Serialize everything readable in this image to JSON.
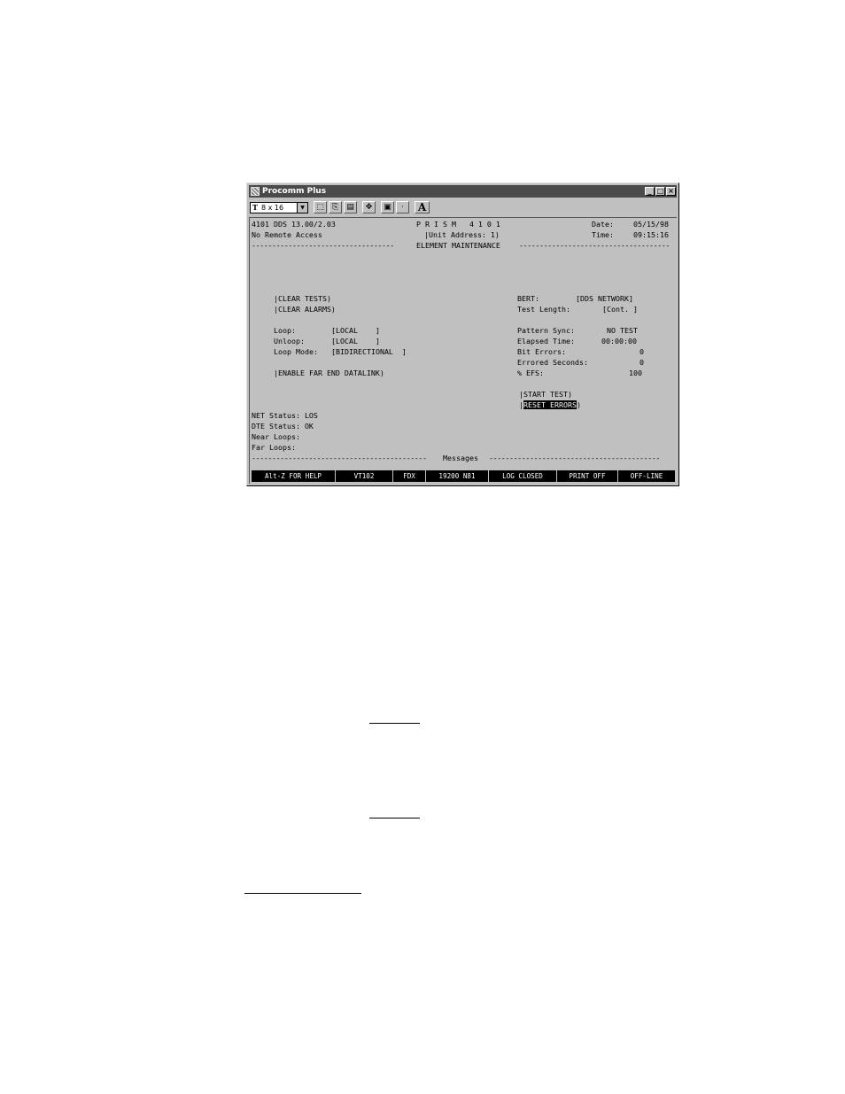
{
  "window": {
    "title": "Procomm Plus",
    "controls": {
      "minimize": "_",
      "maximize": "□",
      "close": "×"
    }
  },
  "toolbar": {
    "font_selector": "8 x 16",
    "font_icon": "T",
    "buttons": [
      {
        "name": "select-icon",
        "glyph": "⬚"
      },
      {
        "name": "copy-icon",
        "glyph": "⎘"
      },
      {
        "name": "paste-icon",
        "glyph": "▤"
      },
      {
        "name": "move-icon",
        "glyph": "✥"
      },
      {
        "name": "print-screen-icon",
        "glyph": "▣"
      },
      {
        "name": "dot-icon",
        "glyph": "·"
      },
      {
        "name": "font-a-icon",
        "glyph": "A"
      }
    ]
  },
  "terminal": {
    "header": {
      "version": "4101 DDS 13.00/2.03",
      "product": "P R I S M   4 1 0 1",
      "date_label": "Date:",
      "date": "05/15/98",
      "remote": "No Remote Access",
      "unit_address": "|Unit Address: 1)",
      "time_label": "Time:",
      "time": "09:15:16",
      "section_title": "ELEMENT MAINTENANCE"
    },
    "left": {
      "clear_tests": "|CLEAR TESTS)",
      "clear_alarms": "|CLEAR ALARMS)",
      "loop_label": "Loop:",
      "loop_value": "[LOCAL    ]",
      "unloop_label": "Unloop:",
      "unloop_value": "[LOCAL    ]",
      "loop_mode_label": "Loop Mode:",
      "loop_mode_value": "[BIDIRECTIONAL  ]",
      "enable_far_end": "|ENABLE FAR END DATALINK)"
    },
    "right": {
      "bert_label": "BERT:",
      "bert_value": "[DDS NETWORK]",
      "test_length_label": "Test Length:",
      "test_length_value": "[Cont. ]",
      "pattern_sync_label": "Pattern Sync:",
      "pattern_sync_value": "NO TEST",
      "elapsed_label": "Elapsed Time:",
      "elapsed_value": "00:00:00",
      "bit_errors_label": "Bit Errors:",
      "bit_errors_value": "0",
      "errored_seconds_label": "Errored Seconds:",
      "errored_seconds_value": "0",
      "efs_label": "% EFS:",
      "efs_value": "100",
      "start_test": "|START TEST)",
      "reset_prefix": "|",
      "reset_errors": "RESET ERRORS",
      "reset_suffix": ")"
    },
    "status": {
      "net": "NET Status: LOS",
      "dte": "DTE Status: OK",
      "near": "Near Loops:",
      "far": "Far Loops:"
    },
    "messages_title": "Messages"
  },
  "statusbar": [
    "Alt-Z FOR HELP",
    "VT102",
    "FDX",
    "19200 N81",
    "LOG CLOSED",
    "PRINT OFF",
    "OFF-LINE"
  ]
}
